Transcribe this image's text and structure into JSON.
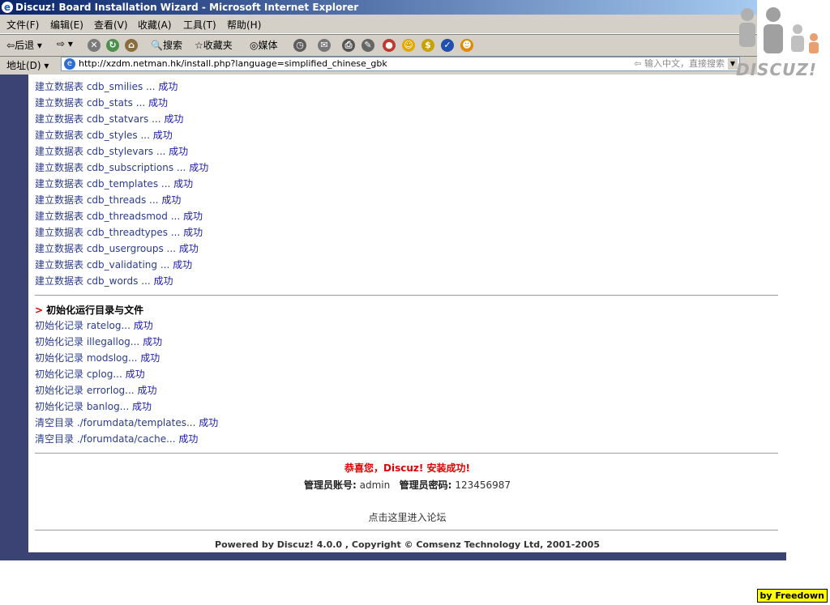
{
  "window": {
    "title": "Discuz! Board Installation Wizard - Microsoft Internet Explorer"
  },
  "menu": [
    "文件(F)",
    "编辑(E)",
    "查看(V)",
    "收藏(A)",
    "工具(T)",
    "帮助(H)"
  ],
  "toolbar": {
    "back_label": "后退",
    "search_label": "搜索",
    "favorites_label": "收藏夹",
    "media_label": "媒体"
  },
  "address": {
    "label": "地址(D)",
    "url": "http://xzdm.netman.hk/install.php?language=simplified_chinese_gbk",
    "search_placeholder": "输入中文，直接搜索"
  },
  "table_log": [
    {
      "text": "建立数据表 cdb_smilies ...",
      "status": "成功"
    },
    {
      "text": "建立数据表 cdb_stats ...",
      "status": "成功"
    },
    {
      "text": "建立数据表 cdb_statvars ...",
      "status": "成功"
    },
    {
      "text": "建立数据表 cdb_styles ...",
      "status": "成功"
    },
    {
      "text": "建立数据表 cdb_stylevars ...",
      "status": "成功"
    },
    {
      "text": "建立数据表 cdb_subscriptions ...",
      "status": "成功"
    },
    {
      "text": "建立数据表 cdb_templates ...",
      "status": "成功"
    },
    {
      "text": "建立数据表 cdb_threads ...",
      "status": "成功"
    },
    {
      "text": "建立数据表 cdb_threadsmod ...",
      "status": "成功"
    },
    {
      "text": "建立数据表 cdb_threadtypes ...",
      "status": "成功"
    },
    {
      "text": "建立数据表 cdb_usergroups ...",
      "status": "成功"
    },
    {
      "text": "建立数据表 cdb_validating ...",
      "status": "成功"
    },
    {
      "text": "建立数据表 cdb_words ...",
      "status": "成功"
    }
  ],
  "init_section": {
    "arrow": ">",
    "title": "初始化运行目录与文件"
  },
  "init_log": [
    {
      "text": "初始化记录 ratelog...",
      "status": "成功"
    },
    {
      "text": "初始化记录 illegallog...",
      "status": "成功"
    },
    {
      "text": "初始化记录 modslog...",
      "status": "成功"
    },
    {
      "text": "初始化记录 cplog...",
      "status": "成功"
    },
    {
      "text": "初始化记录 errorlog...",
      "status": "成功"
    },
    {
      "text": "初始化记录 banlog...",
      "status": "成功"
    },
    {
      "text": "清空目录 ./forumdata/templates...",
      "status": "成功"
    },
    {
      "text": "清空目录 ./forumdata/cache...",
      "status": "成功"
    }
  ],
  "result": {
    "success_message": "恭喜您，Discuz! 安装成功!",
    "admin_account_label": "管理员账号:",
    "admin_account": "admin",
    "admin_password_label": "管理员密码:",
    "admin_password": "123456987",
    "enter_link": "点击这里进入论坛"
  },
  "footer": "Powered by Discuz! 4.0.0 ,  Copyright © Comsenz Technology Ltd, 2001-2005",
  "overlay": {
    "logo_text": "DISCUZ!",
    "badge": "by Freedown"
  }
}
